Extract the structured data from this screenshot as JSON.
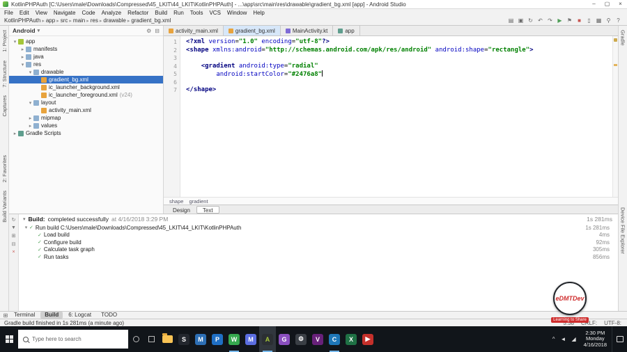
{
  "icons": {
    "caret_down": "▾",
    "gear": "⚙",
    "collapse_all": "⊟",
    "minimize": "–",
    "maximize": "▢",
    "close": "×",
    "tool_windows": "⊞"
  },
  "title_bar": {
    "title": "KotlinPHPAuth [C:\\Users\\male\\Downloads\\Compressed\\45_LKIT\\44_LKIT\\KotlinPHPAuth] - ...\\app\\src\\main\\res\\drawable\\gradient_bg.xml [app] - Android Studio"
  },
  "menu_bar": [
    "File",
    "Edit",
    "View",
    "Navigate",
    "Code",
    "Analyze",
    "Refactor",
    "Build",
    "Run",
    "Tools",
    "VCS",
    "Window",
    "Help"
  ],
  "toolbar": {
    "breadcrumb": [
      "KotlinPHPAuth",
      "app",
      "src",
      "main",
      "res",
      "drawable",
      "gradient_bg.xml"
    ],
    "icons": [
      {
        "name": "open-file-icon",
        "glyph": "▤"
      },
      {
        "name": "save-all-icon",
        "glyph": "▣"
      },
      {
        "name": "sync-icon",
        "glyph": "↻"
      },
      {
        "name": "undo-icon",
        "glyph": "↶"
      },
      {
        "name": "redo-icon",
        "glyph": "↷"
      },
      {
        "name": "run-icon",
        "glyph": "▶",
        "color": "#4f9e57"
      },
      {
        "name": "debug-icon",
        "glyph": "⚑",
        "color": "#777777"
      },
      {
        "name": "stop-icon",
        "glyph": "■",
        "color": "#c75450"
      },
      {
        "name": "avd-manager-icon",
        "glyph": "▯"
      },
      {
        "name": "sdk-manager-icon",
        "glyph": "▦"
      },
      {
        "name": "search-icon",
        "glyph": "⚲"
      },
      {
        "name": "help-icon",
        "glyph": "?"
      }
    ]
  },
  "tool_strips": {
    "left_top": [
      "1: Project",
      "7: Structure",
      "Captures"
    ],
    "left_mid": [
      "2: Favorites",
      "Build Variants"
    ],
    "right_top": [
      "Gradle"
    ],
    "right_bottom": [
      "Device File Explorer"
    ]
  },
  "project_panel": {
    "view_selector": "Android",
    "tree": [
      {
        "label": "app",
        "level": 0,
        "arrow": "expanded",
        "icon": "app"
      },
      {
        "label": "manifests",
        "level": 1,
        "arrow": "collapsed",
        "icon": "folder"
      },
      {
        "label": "java",
        "level": 1,
        "arrow": "collapsed",
        "icon": "folder"
      },
      {
        "label": "res",
        "level": 1,
        "arrow": "expanded",
        "icon": "folder"
      },
      {
        "label": "drawable",
        "level": 2,
        "arrow": "expanded",
        "icon": "folder"
      },
      {
        "label": "gradient_bg.xml",
        "level": 3,
        "arrow": "none",
        "icon": "xml",
        "selected": true
      },
      {
        "label": "ic_launcher_background.xml",
        "level": 3,
        "arrow": "none",
        "icon": "xml"
      },
      {
        "label": "ic_launcher_foreground.xml",
        "level": 3,
        "arrow": "none",
        "icon": "xml",
        "suffix": "(v24)"
      },
      {
        "label": "layout",
        "level": 2,
        "arrow": "expanded",
        "icon": "folder"
      },
      {
        "label": "activity_main.xml",
        "level": 3,
        "arrow": "none",
        "icon": "xml"
      },
      {
        "label": "mipmap",
        "level": 2,
        "arrow": "collapsed",
        "icon": "folder"
      },
      {
        "label": "values",
        "level": 2,
        "arrow": "collapsed",
        "icon": "folder"
      },
      {
        "label": "Gradle Scripts",
        "level": 0,
        "arrow": "collapsed",
        "icon": "gradle"
      }
    ]
  },
  "editor": {
    "tabs": [
      {
        "label": "activity_main.xml",
        "icon": "xml",
        "active": false
      },
      {
        "label": "gradient_bg.xml",
        "icon": "xml",
        "active": true
      },
      {
        "label": "MainActivity.kt",
        "icon": "kotlin",
        "active": false
      },
      {
        "label": "app",
        "icon": "gradle",
        "active": false
      }
    ],
    "lines": [
      {
        "num": "1",
        "tokens": [
          [
            "tag",
            "<?xml "
          ],
          [
            "attr",
            "version"
          ],
          [
            "plain",
            "="
          ],
          [
            "value",
            "\"1.0\""
          ],
          [
            "plain",
            " "
          ],
          [
            "attr",
            "encoding"
          ],
          [
            "plain",
            "="
          ],
          [
            "value",
            "\"utf-8\""
          ],
          [
            "tag",
            "?>"
          ]
        ]
      },
      {
        "num": "2",
        "tokens": [
          [
            "tag",
            "<shape "
          ],
          [
            "attr",
            "xmlns:android"
          ],
          [
            "plain",
            "="
          ],
          [
            "value",
            "\"http://schemas.android.com/apk/res/android\""
          ],
          [
            "plain",
            " "
          ],
          [
            "attr",
            "android:shape"
          ],
          [
            "plain",
            "="
          ],
          [
            "value",
            "\"rectangle\""
          ],
          [
            "tag",
            ">"
          ]
        ]
      },
      {
        "num": "3",
        "tokens": []
      },
      {
        "num": "4",
        "tokens": [
          [
            "plain",
            "    "
          ],
          [
            "tag",
            "<gradient "
          ],
          [
            "attr",
            "android:type"
          ],
          [
            "plain",
            "="
          ],
          [
            "value",
            "\"radial\""
          ]
        ]
      },
      {
        "num": "5",
        "tokens": [
          [
            "plain",
            "        "
          ],
          [
            "attr",
            "android:startColor"
          ],
          [
            "plain",
            "="
          ],
          [
            "value",
            "\"#2476a8\""
          ],
          [
            "cursor",
            ""
          ]
        ]
      },
      {
        "num": "6",
        "tokens": []
      },
      {
        "num": "7",
        "tokens": [
          [
            "tag",
            "</shape>"
          ]
        ]
      }
    ],
    "xml_breadcrumb": [
      "shape",
      "gradient"
    ],
    "mode_tabs": [
      {
        "label": "Design",
        "active": false
      },
      {
        "label": "Text",
        "active": true
      }
    ]
  },
  "build_panel": {
    "title": "Build:",
    "status": "completed successfully",
    "timestamp": "at 4/16/2018 3:29 PM",
    "total_time": "1s 281ms",
    "side_icons": [
      {
        "name": "restart-build-icon",
        "glyph": "↻"
      },
      {
        "name": "filter-icon",
        "glyph": "▼"
      },
      {
        "name": "expand-all-icon",
        "glyph": "⊞"
      },
      {
        "name": "collapse-all-icon",
        "glyph": "⊟"
      },
      {
        "name": "close-icon",
        "glyph": "×",
        "color": "#c75450"
      }
    ],
    "rows": [
      {
        "label": "Run build C:\\Users\\male\\Downloads\\Compressed\\45_LKIT\\44_LKIT\\KotlinPHPAuth",
        "time": "1s 281ms",
        "level": 0
      },
      {
        "label": "Load build",
        "time": "4ms",
        "level": 1
      },
      {
        "label": "Configure build",
        "time": "92ms",
        "level": 1
      },
      {
        "label": "Calculate task graph",
        "time": "305ms",
        "level": 1
      },
      {
        "label": "Run tasks",
        "time": "856ms",
        "level": 1
      }
    ]
  },
  "bottom_tabs": [
    {
      "label": "Terminal",
      "active": false
    },
    {
      "label": "Build",
      "active": true
    },
    {
      "label": "6: Logcat",
      "active": false
    },
    {
      "label": "TODO",
      "active": false
    }
  ],
  "status_bar": {
    "left": "Gradle build finished in 1s 281ms (a minute ago)",
    "right": [
      "5:38",
      "CRLF:",
      "UTF-8:"
    ]
  },
  "taskbar": {
    "search_placeholder": "Type here to search",
    "apps": [
      {
        "name": "file-explorer-icon",
        "kind": "folder"
      },
      {
        "name": "microsoft-store-icon",
        "letter": "S",
        "bg": "#23272e"
      },
      {
        "name": "mail-icon",
        "letter": "M",
        "bg": "#2d6fb5"
      },
      {
        "name": "photos-icon",
        "letter": "P",
        "bg": "#1f6fc4"
      },
      {
        "name": "whatsapp-icon",
        "letter": "W",
        "bg": "#36a94f",
        "open": true
      },
      {
        "name": "messenger-icon",
        "letter": "M",
        "bg": "#5b6ee1"
      },
      {
        "name": "android-studio-icon",
        "letter": "A",
        "bg": "#2b2f33",
        "fg": "#a4c639",
        "active": true,
        "open": true
      },
      {
        "name": "gallery-icon",
        "letter": "G",
        "bg": "#8a4fbf"
      },
      {
        "name": "settings-icon",
        "letter": "⚙",
        "bg": "#3a3f45"
      },
      {
        "name": "visual-studio-icon",
        "letter": "V",
        "bg": "#68217a"
      },
      {
        "name": "code-editor-icon",
        "letter": "C",
        "bg": "#1e77b8",
        "open": true
      },
      {
        "name": "excel-icon",
        "letter": "X",
        "bg": "#1f7145"
      },
      {
        "name": "media-player-icon",
        "letter": "▶",
        "bg": "#c4302b"
      }
    ],
    "tray_icons": [
      {
        "name": "hidden-icons-chevron",
        "glyph": "^"
      },
      {
        "name": "volume-icon",
        "glyph": "◄"
      },
      {
        "name": "network-icon",
        "glyph": "◢"
      }
    ],
    "tray": {
      "time": "2:30 PM",
      "day": "Monday",
      "date": "4/16/2018"
    }
  },
  "watermark": {
    "title": "eDMTDev",
    "subtitle": "Learning to Share"
  }
}
